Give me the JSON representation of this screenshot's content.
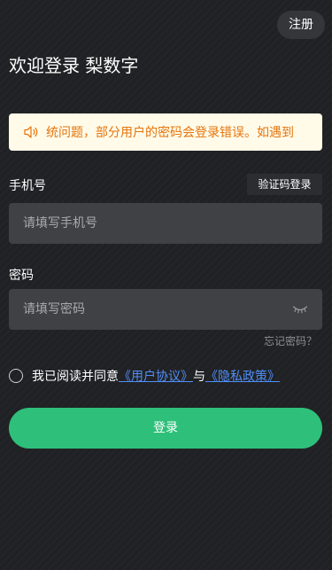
{
  "header": {
    "register_label": "注册"
  },
  "welcome": {
    "title": "欢迎登录 梨数字"
  },
  "notice": {
    "icon": "speaker-icon",
    "text": "统问题，部分用户的密码会登录错误。如遇到",
    "text_color": "#e6740d",
    "background": "#fffbe8"
  },
  "phone": {
    "label": "手机号",
    "switch_label": "验证码登录",
    "placeholder": "请填写手机号",
    "value": ""
  },
  "password": {
    "label": "密码",
    "placeholder": "请填写密码",
    "value": "",
    "toggle_icon": "eye-closed-icon",
    "forgot_label": "忘记密码？"
  },
  "agreement": {
    "prefix": "我已阅读并同意",
    "user_agreement": "《用户协议》",
    "connector": "与",
    "privacy_policy": "《隐私政策》",
    "checked": false,
    "link_color": "#4f8ff7"
  },
  "login": {
    "label": "登录",
    "color": "#2ec07a"
  }
}
